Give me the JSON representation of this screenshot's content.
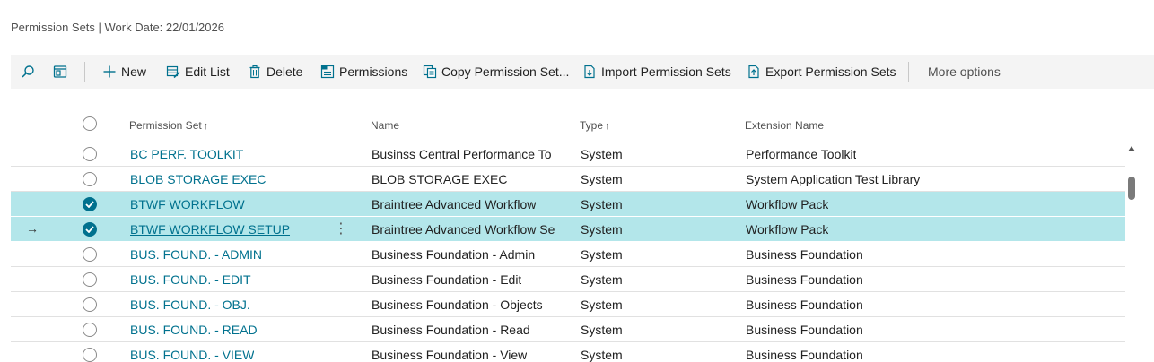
{
  "header": {
    "title": "Permission Sets | Work Date: 22/01/2026"
  },
  "actions": {
    "new": "New",
    "edit_list": "Edit List",
    "delete": "Delete",
    "permissions": "Permissions",
    "copy": "Copy Permission Set...",
    "import": "Import Permission Sets",
    "export": "Export Permission Sets",
    "more": "More options"
  },
  "columns": {
    "permission_set": "Permission Set",
    "name": "Name",
    "type": "Type",
    "extension": "Extension Name",
    "sort_arrow": "↑"
  },
  "rows": [
    {
      "permission_set": "BC PERF. TOOLKIT",
      "name": "Businss Central Performance To",
      "type": "System",
      "extension": "Performance Toolkit",
      "selected": false
    },
    {
      "permission_set": "BLOB STORAGE EXEC",
      "name": "BLOB STORAGE EXEC",
      "type": "System",
      "extension": "System Application Test Library",
      "selected": false
    },
    {
      "permission_set": "BTWF WORKFLOW",
      "name": "Braintree Advanced Workflow",
      "type": "System",
      "extension": "Workflow Pack",
      "selected": true
    },
    {
      "permission_set": "BTWF WORKFLOW SETUP",
      "name": "Braintree Advanced Workflow Se",
      "type": "System",
      "extension": "Workflow Pack",
      "selected": true,
      "current": true
    },
    {
      "permission_set": "BUS. FOUND. - ADMIN",
      "name": "Business Foundation - Admin",
      "type": "System",
      "extension": "Business Foundation",
      "selected": false
    },
    {
      "permission_set": "BUS. FOUND. - EDIT",
      "name": "Business Foundation - Edit",
      "type": "System",
      "extension": "Business Foundation",
      "selected": false
    },
    {
      "permission_set": "BUS. FOUND. - OBJ.",
      "name": "Business Foundation - Objects",
      "type": "System",
      "extension": "Business Foundation",
      "selected": false
    },
    {
      "permission_set": "BUS. FOUND. - READ",
      "name": "Business Foundation - Read",
      "type": "System",
      "extension": "Business Foundation",
      "selected": false
    },
    {
      "permission_set": "BUS. FOUND. - VIEW",
      "name": "Business Foundation - View",
      "type": "System",
      "extension": "Business Foundation",
      "selected": false
    }
  ],
  "row_marker": "→",
  "row_menu": "⋮",
  "colors": {
    "accent": "#00718e",
    "selected_row": "#b3e6ea"
  }
}
